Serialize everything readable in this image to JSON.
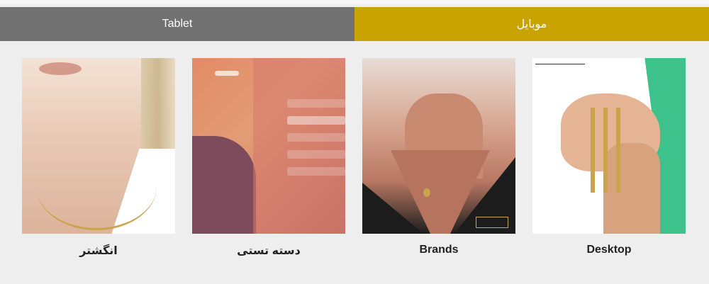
{
  "tabs": [
    {
      "label": "Tablet",
      "active": false
    },
    {
      "label": "موبایل",
      "active": true
    }
  ],
  "colors": {
    "tab_tablet_bg": "#717171",
    "tab_mobile_bg": "#c9a300",
    "page_bg": "#eeeeee"
  },
  "cards": [
    {
      "caption": "انگشتر",
      "image": "necklace-model-photo"
    },
    {
      "caption": "دسته تستی",
      "image": "tablet-ui-mockup"
    },
    {
      "caption": "Brands",
      "image": "pendant-model-photo"
    },
    {
      "caption": "Desktop",
      "image": "bracelets-hand-photo"
    }
  ]
}
